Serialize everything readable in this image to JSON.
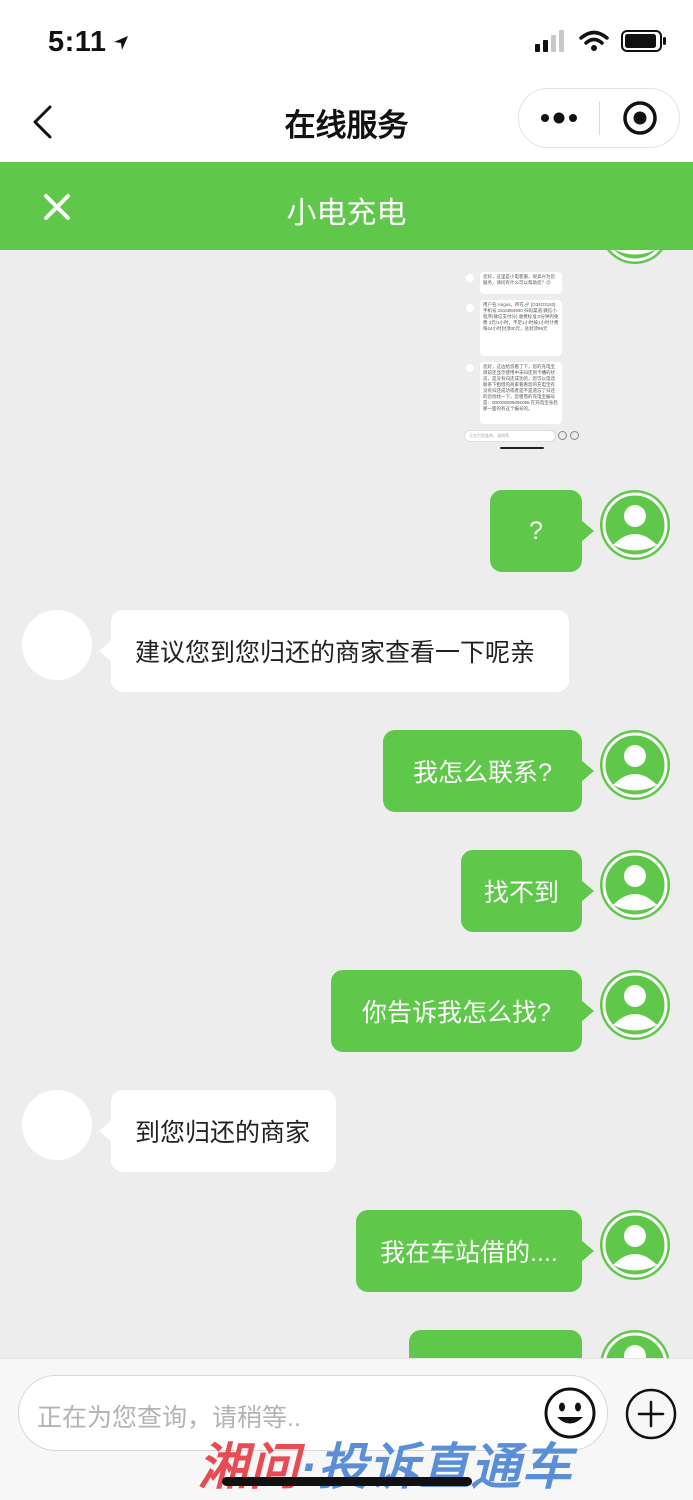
{
  "status": {
    "time": "5:11"
  },
  "nav": {
    "title": "在线服务"
  },
  "header": {
    "title": "小电充电"
  },
  "embedded_screenshot": {
    "greeting": "您好，这里是小电客服，很高兴为您服务，请问有什么可以帮助您？😊",
    "user_info": "用户名:Angus。所在🔗 [O34O3163] 手机号:1516884900 扫码渠道:微信小程序(微信支付分) 收费标准:5分钟内免费 3元/1小时，不足1小时按1小时计费 每24小时封顶30元，总封顶99元",
    "reply": "您好，这边给您看了下，您的充电宝目前还显示使用中未归还到卡槽的状态，是没有归还成功的，您可以电话联系下租借的商家看看您的充电宝有没有归还成功或者是不是遗忘了归还的您找找一下。您租借的充电宝编号是：000000006095096  在充电宝身后那一面的有这个编号的。",
    "input_placeholder": "正在为您查询，请稍等.."
  },
  "messages": [
    {
      "from": "user",
      "text": "?"
    },
    {
      "from": "agent",
      "text": "建议您到您归还的商家查看一下呢亲"
    },
    {
      "from": "user",
      "text": "我怎么联系?"
    },
    {
      "from": "user",
      "text": "找不到"
    },
    {
      "from": "user",
      "text": "你告诉我怎么找?"
    },
    {
      "from": "agent",
      "text": "到您归还的商家"
    },
    {
      "from": "user",
      "text": "我在车站借的...."
    },
    {
      "from": "user",
      "text": ""
    }
  ],
  "input": {
    "placeholder": "正在为您查询，请稍等.."
  },
  "watermark": {
    "part_a": "湘问",
    "part_b": "·投诉直通车"
  },
  "colors": {
    "brand_green": "#5fc74a",
    "chat_bg": "#ededed"
  },
  "icons": {
    "back": "chevron-left-icon",
    "more": "more-dots-icon",
    "target": "target-icon",
    "close": "close-icon",
    "emoji": "emoji-icon",
    "plus": "plus-icon"
  }
}
